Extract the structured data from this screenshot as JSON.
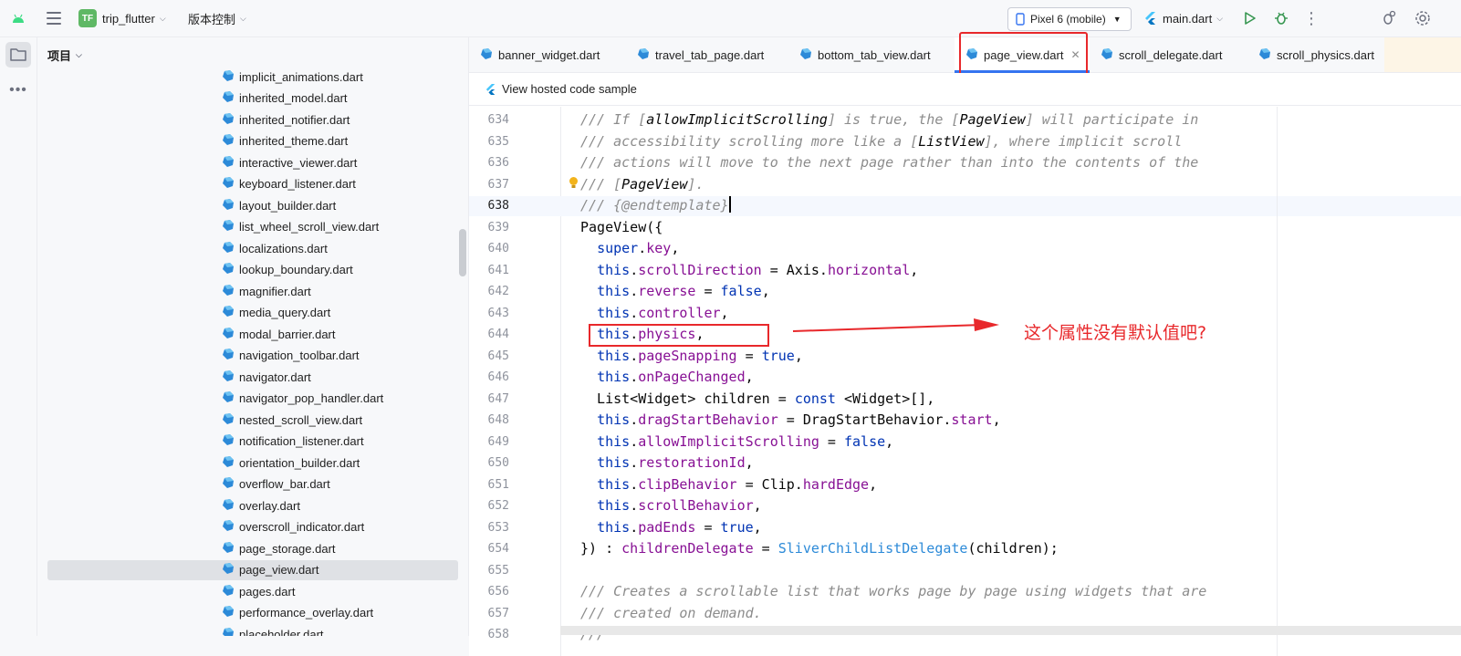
{
  "toolbar": {
    "project_badge": "TF",
    "project_name": "trip_flutter",
    "vcs_label": "版本控制",
    "device": "Pixel 6 (mobile)",
    "run_config": "main.dart"
  },
  "panel": {
    "title": "项目",
    "files": [
      {
        "name": "implicit_animations.dart"
      },
      {
        "name": "inherited_model.dart"
      },
      {
        "name": "inherited_notifier.dart"
      },
      {
        "name": "inherited_theme.dart"
      },
      {
        "name": "interactive_viewer.dart"
      },
      {
        "name": "keyboard_listener.dart"
      },
      {
        "name": "layout_builder.dart"
      },
      {
        "name": "list_wheel_scroll_view.dart"
      },
      {
        "name": "localizations.dart"
      },
      {
        "name": "lookup_boundary.dart"
      },
      {
        "name": "magnifier.dart"
      },
      {
        "name": "media_query.dart"
      },
      {
        "name": "modal_barrier.dart"
      },
      {
        "name": "navigation_toolbar.dart"
      },
      {
        "name": "navigator.dart"
      },
      {
        "name": "navigator_pop_handler.dart"
      },
      {
        "name": "nested_scroll_view.dart"
      },
      {
        "name": "notification_listener.dart"
      },
      {
        "name": "orientation_builder.dart"
      },
      {
        "name": "overflow_bar.dart"
      },
      {
        "name": "overlay.dart"
      },
      {
        "name": "overscroll_indicator.dart"
      },
      {
        "name": "page_storage.dart"
      },
      {
        "name": "page_view.dart",
        "selected": true
      },
      {
        "name": "pages.dart"
      },
      {
        "name": "performance_overlay.dart"
      },
      {
        "name": "placeholder.dart"
      }
    ]
  },
  "tabs": [
    {
      "label": "banner_widget.dart"
    },
    {
      "label": "travel_tab_page.dart"
    },
    {
      "label": "bottom_tab_view.dart"
    },
    {
      "label": "page_view.dart",
      "active": true
    },
    {
      "label": "scroll_delegate.dart"
    },
    {
      "label": "scroll_physics.dart"
    }
  ],
  "banner": {
    "text": "View hosted code sample"
  },
  "code": {
    "cursor_line": "638",
    "lines": [
      {
        "n": "634",
        "t": "/// If [allowImplicitScrolling] is true, the [PageView] will participate in"
      },
      {
        "n": "635",
        "t": "/// accessibility scrolling more like a [ListView], where implicit scroll"
      },
      {
        "n": "636",
        "t": "/// actions will move to the next page rather than into the contents of the"
      },
      {
        "n": "637",
        "t": "/// [PageView]."
      },
      {
        "n": "638",
        "t": "/// {@endtemplate}"
      },
      {
        "n": "639",
        "t": "PageView({"
      },
      {
        "n": "640",
        "t": "  super.key,"
      },
      {
        "n": "641",
        "t": "  this.scrollDirection = Axis.horizontal,"
      },
      {
        "n": "642",
        "t": "  this.reverse = false,"
      },
      {
        "n": "643",
        "t": "  this.controller,"
      },
      {
        "n": "644",
        "t": "  this.physics,"
      },
      {
        "n": "645",
        "t": "  this.pageSnapping = true,"
      },
      {
        "n": "646",
        "t": "  this.onPageChanged,"
      },
      {
        "n": "647",
        "t": "  List<Widget> children = const <Widget>[],"
      },
      {
        "n": "648",
        "t": "  this.dragStartBehavior = DragStartBehavior.start,"
      },
      {
        "n": "649",
        "t": "  this.allowImplicitScrolling = false,"
      },
      {
        "n": "650",
        "t": "  this.restorationId,"
      },
      {
        "n": "651",
        "t": "  this.clipBehavior = Clip.hardEdge,"
      },
      {
        "n": "652",
        "t": "  this.scrollBehavior,"
      },
      {
        "n": "653",
        "t": "  this.padEnds = true,"
      },
      {
        "n": "654",
        "t": "}) : childrenDelegate = SliverChildListDelegate(children);"
      },
      {
        "n": "655",
        "t": ""
      },
      {
        "n": "656",
        "t": "/// Creates a scrollable list that works page by page using widgets that are"
      },
      {
        "n": "657",
        "t": "/// created on demand."
      },
      {
        "n": "658",
        "t": "///"
      }
    ]
  },
  "annotation": {
    "text": "这个属性没有默认值吧?"
  },
  "colors": {
    "accent": "#3574f0",
    "annotation_red": "#e8282b",
    "dart_blue": "#2c8ad8"
  }
}
